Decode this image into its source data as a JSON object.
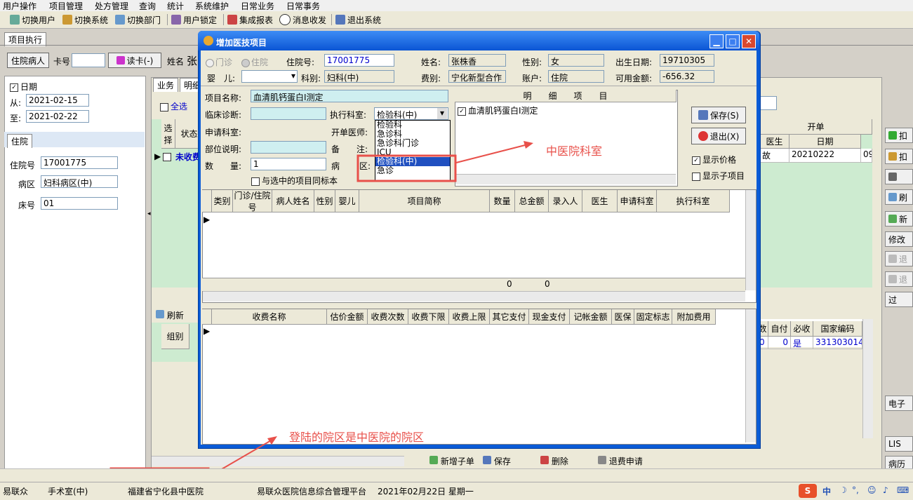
{
  "menu": [
    "用户操作",
    "项目管理",
    "处方管理",
    "查询",
    "统计",
    "系统维护",
    "日常业务",
    "日常事务"
  ],
  "toolbar": [
    "切换用户",
    "切换系统",
    "切换部门",
    "用户锁定",
    "集成报表",
    "消息收发",
    "退出系统"
  ],
  "main": {
    "tab": "项目执行",
    "patient_btn": "住院病人",
    "card_label": "卡号",
    "read_card_btn": "读卡(-)",
    "name_label": "姓名",
    "name_value_partial": "张",
    "date_check_label": "日期",
    "from_label": "从:",
    "from_value": "2021-02-15",
    "to_label": "至:",
    "to_value": "2021-02-22",
    "sub_tab": "住院",
    "hosp_no_label": "住院号",
    "hosp_no_value": "17001775",
    "ward_label": "病区",
    "ward_value": "妇科病区(中)",
    "bed_label": "床号",
    "bed_value": "01",
    "biz_tabs": [
      "业务",
      "明细"
    ],
    "select_all": "全选",
    "grid_cols": [
      "选择",
      "状态"
    ],
    "grid_row_status": "未收费",
    "refresh_btn": "刷新",
    "group_col": "组别",
    "right_grid_header": "开单",
    "right_grid_cols": [
      "医生",
      "日期"
    ],
    "right_grid_row": [
      "故",
      "20210222",
      "09"
    ],
    "lower_right_cols": [
      "数",
      "自付",
      "必收",
      "国家编码"
    ],
    "lower_right_row": [
      "0",
      "0",
      "是",
      "331303014"
    ],
    "bottom_btns": [
      "新增子单",
      "保存",
      "删除",
      "退费申请"
    ],
    "side_btns": [
      "扣",
      "扣",
      "",
      "刷",
      "新",
      "修改",
      "退",
      "退",
      "过",
      "电子",
      "LIS",
      "病历"
    ]
  },
  "dialog": {
    "title": "增加医技项目",
    "radio_outpatient": "门诊",
    "radio_inpatient": "住院",
    "hosp_no_label": "住院号:",
    "hosp_no_value": "17001775",
    "name_label": "姓名:",
    "name_value": "张株香",
    "gender_label": "性别:",
    "gender_value": "女",
    "birth_label": "出生日期:",
    "birth_value": "19710305",
    "baby_label": "婴　儿:",
    "dept_label": "科别:",
    "dept_value": "妇科(中)",
    "fee_label": "费别:",
    "fee_value": "宁化新型合作",
    "account_label": "账户:",
    "account_value": "住院",
    "balance_label": "可用金额:",
    "balance_value": "-656.32",
    "item_name_label": "项目名称:",
    "item_name_value": "血清肌钙蛋白Ⅰ测定",
    "diagnosis_label": "临床诊断:",
    "exec_dept_label": "执行科室:",
    "exec_dept_value": "检验科(中)",
    "apply_dept_label": "申请科室:",
    "doctor_label": "开单医师:",
    "part_label": "部位说明:",
    "note_label": "备　　注:",
    "qty_label": "数　　量:",
    "qty_value": "1",
    "ward_label": "病",
    "ward_label2": "区:",
    "same_specimen_label": "与选中的项目同标本",
    "dropdown_options": [
      "检验科",
      "急诊科",
      "急诊科门诊",
      "ICU",
      "检验科(中)",
      "急诊"
    ],
    "dropdown_selected": "检验科(中)",
    "detail_header": "明　　细　　项　　目",
    "detail_item": "血清肌钙蛋白Ⅰ测定",
    "save_btn": "保存(S)",
    "exit_btn": "退出(X)",
    "show_price": "显示价格",
    "show_sub": "显示子项目",
    "grid1_cols": [
      "类别",
      "门诊/住院号",
      "病人姓名",
      "性别",
      "婴儿",
      "项目简称",
      "数量",
      "总金额",
      "录入人",
      "医生",
      "申请科室",
      "执行科室"
    ],
    "grid1_footer": [
      "0",
      "0"
    ],
    "grid2_cols": [
      "收费名称",
      "估价金额",
      "收费次数",
      "收费下限",
      "收费上限",
      "其它支付",
      "现金支付",
      "记帐金额",
      "医保",
      "固定标志",
      "附加费用"
    ]
  },
  "annotations": {
    "right_note": "中医院科室",
    "bottom_note": "登陆的院区是中医院的院区",
    "color": "#e8504a"
  },
  "status": [
    "易联众",
    "手术室(中)",
    "福建省宁化县中医院",
    "易联众医院信息综合管理平台",
    "2021年02月22日 星期一"
  ],
  "tray": [
    "中"
  ]
}
